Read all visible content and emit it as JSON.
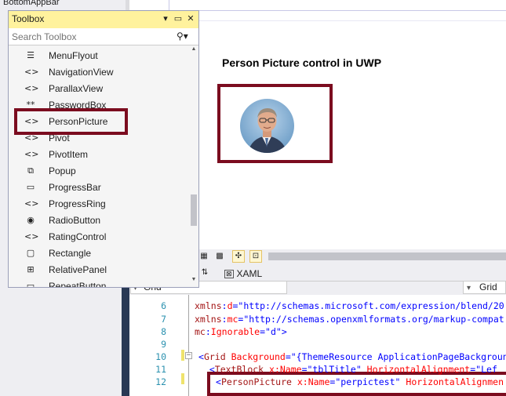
{
  "background": {
    "top_item": "BottomAppBar"
  },
  "toolbox": {
    "title": "Toolbox",
    "search_placeholder": "Search Toolbox",
    "items": [
      {
        "label": "MenuFlyout",
        "icon": "menu-flyout-icon",
        "glyph": "☰"
      },
      {
        "label": "NavigationView",
        "icon": "code-brackets-icon",
        "glyph": "<>"
      },
      {
        "label": "ParallaxView",
        "icon": "code-brackets-icon",
        "glyph": "<>"
      },
      {
        "label": "PasswordBox",
        "icon": "password-box-icon",
        "glyph": "**"
      },
      {
        "label": "PersonPicture",
        "icon": "code-brackets-icon",
        "glyph": "<>"
      },
      {
        "label": "Pivot",
        "icon": "code-brackets-icon",
        "glyph": "<>"
      },
      {
        "label": "PivotItem",
        "icon": "code-brackets-icon",
        "glyph": "<>"
      },
      {
        "label": "Popup",
        "icon": "popup-icon",
        "glyph": "⧉"
      },
      {
        "label": "ProgressBar",
        "icon": "progress-bar-icon",
        "glyph": "▭"
      },
      {
        "label": "ProgressRing",
        "icon": "code-brackets-icon",
        "glyph": "<>"
      },
      {
        "label": "RadioButton",
        "icon": "radio-button-icon",
        "glyph": "◉"
      },
      {
        "label": "RatingControl",
        "icon": "code-brackets-icon",
        "glyph": "<>"
      },
      {
        "label": "Rectangle",
        "icon": "rectangle-icon",
        "glyph": "▢"
      },
      {
        "label": "RelativePanel",
        "icon": "relative-panel-icon",
        "glyph": "⊞"
      },
      {
        "label": "RepeatButton",
        "icon": "repeat-button-icon",
        "glyph": "▭"
      }
    ],
    "highlighted_item": "PersonPicture"
  },
  "designer": {
    "title": "Person Picture control in UWP",
    "xaml_tab": "XAML"
  },
  "breadcrumb": {
    "left": "Grid",
    "right": "Grid"
  },
  "editor": {
    "line_numbers": [
      "6",
      "7",
      "8",
      "9",
      "10",
      "11",
      "12"
    ],
    "lines": [
      {
        "parts": [
          [
            "c-tag",
            "xmlns"
          ],
          [
            "c-punct",
            ":"
          ],
          [
            "c-attr",
            "d"
          ],
          [
            "c-punct",
            "=\""
          ],
          [
            "c-val",
            "http://schemas.microsoft.com/expression/blend/20"
          ]
        ]
      },
      {
        "parts": [
          [
            "c-tag",
            "xmlns"
          ],
          [
            "c-punct",
            ":"
          ],
          [
            "c-attr",
            "mc"
          ],
          [
            "c-punct",
            "=\""
          ],
          [
            "c-val",
            "http://schemas.openxmlformats.org/markup-compat"
          ]
        ]
      },
      {
        "parts": [
          [
            "c-tag",
            "mc"
          ],
          [
            "c-punct",
            ":"
          ],
          [
            "c-attr",
            "Ignorable"
          ],
          [
            "c-punct",
            "=\""
          ],
          [
            "c-val",
            "d"
          ],
          [
            "c-punct",
            "\">"
          ]
        ]
      },
      {
        "parts": []
      },
      {
        "parts": [
          [
            "c-punct",
            "<"
          ],
          [
            "c-tag",
            "Grid"
          ],
          [
            "c-attr",
            " Background"
          ],
          [
            "c-punct",
            "=\""
          ],
          [
            "c-val",
            "{ThemeResource ApplicationPageBackgroun"
          ]
        ]
      },
      {
        "parts": [
          [
            "c-punct",
            "  <"
          ],
          [
            "c-tag",
            "TextBlock"
          ],
          [
            "c-attr",
            " x:Name"
          ],
          [
            "c-punct",
            "=\""
          ],
          [
            "c-val",
            "tblTitle"
          ],
          [
            "c-punct",
            "\""
          ],
          [
            "c-attr",
            " HorizontalAlignment"
          ],
          [
            "c-punct",
            "=\""
          ],
          [
            "c-val",
            "Lef"
          ]
        ]
      },
      {
        "parts": [
          [
            "c-punct",
            "<"
          ],
          [
            "c-tag",
            "PersonPicture"
          ],
          [
            "c-attr",
            " x:Name"
          ],
          [
            "c-punct",
            "=\""
          ],
          [
            "c-val",
            "perpictest"
          ],
          [
            "c-punct",
            "\""
          ],
          [
            "c-attr",
            " HorizontalAlignmen"
          ]
        ]
      }
    ]
  }
}
